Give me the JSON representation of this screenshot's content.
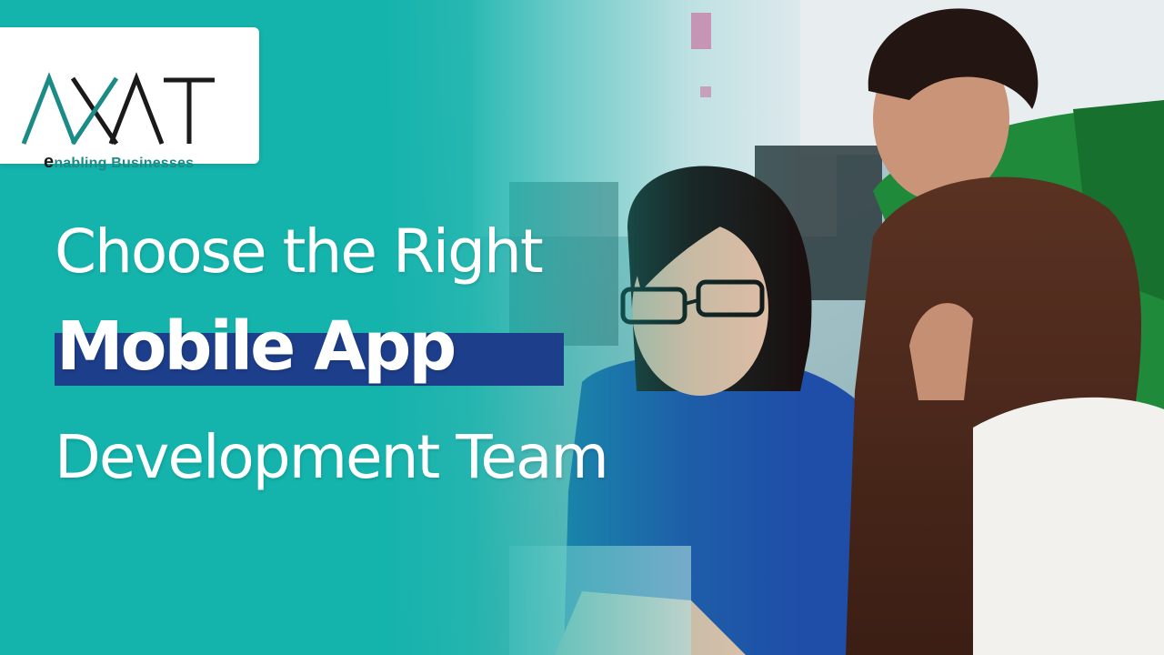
{
  "logo": {
    "wordmark": "AXAT",
    "tagline_rest": "nabling Businesses",
    "brand_teal": "#1a8b86",
    "brand_dark": "#1a1a1a"
  },
  "headline": {
    "line1": "Choose the Right",
    "line2": "Mobile App",
    "line3": "Development Team"
  },
  "colors": {
    "background_teal": "#14b3ac",
    "highlight_navy": "#1d3e8a",
    "text": "#ffffff"
  },
  "icons": {
    "tagline_mark": "e-glyph",
    "photo": "team-at-computer-photo"
  }
}
